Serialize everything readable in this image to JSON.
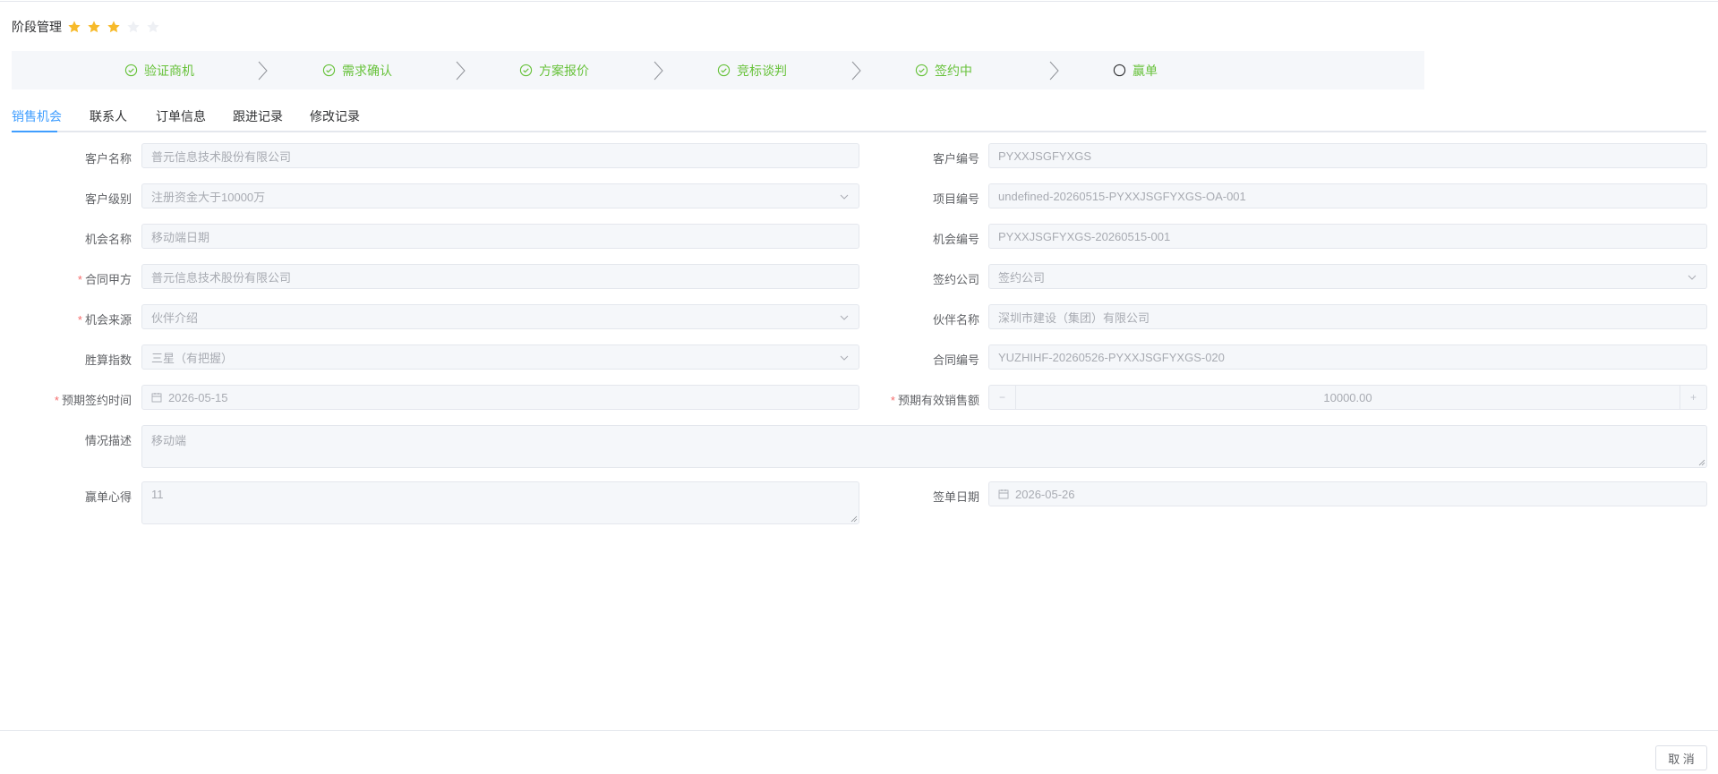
{
  "stage": {
    "title": "阶段管理",
    "rating": 3,
    "rating_max": 5
  },
  "steps": [
    {
      "label": "验证商机",
      "status": "done"
    },
    {
      "label": "需求确认",
      "status": "done"
    },
    {
      "label": "方案报价",
      "status": "done"
    },
    {
      "label": "竞标谈判",
      "status": "done"
    },
    {
      "label": "签约中",
      "status": "done"
    },
    {
      "label": "赢单",
      "status": "current"
    }
  ],
  "tabs": [
    "销售机会",
    "联系人",
    "订单信息",
    "跟进记录",
    "修改记录"
  ],
  "form": {
    "customer_name": {
      "label": "客户名称",
      "value": "普元信息技术股份有限公司"
    },
    "customer_no": {
      "label": "客户编号",
      "value": "PYXXJSGFYXGS"
    },
    "customer_level": {
      "label": "客户级别",
      "value": "注册资金大于10000万"
    },
    "project_no": {
      "label": "项目编号",
      "value": "undefined-20260515-PYXXJSGFYXGS-OA-001"
    },
    "opp_name": {
      "label": "机会名称",
      "value": "移动端日期"
    },
    "opp_no": {
      "label": "机会编号",
      "value": "PYXXJSGFYXGS-20260515-001"
    },
    "contract_party": {
      "label": "合同甲方",
      "value": "普元信息技术股份有限公司"
    },
    "sign_company": {
      "label": "签约公司",
      "placeholder": "签约公司"
    },
    "opp_source": {
      "label": "机会来源",
      "value": "伙伴介绍"
    },
    "partner_name": {
      "label": "伙伴名称",
      "value": "深圳市建设（集团）有限公司"
    },
    "win_index": {
      "label": "胜算指数",
      "value": "三星（有把握）"
    },
    "contract_no": {
      "label": "合同编号",
      "value": "YUZHIHF-20260526-PYXXJSGFYXGS-020"
    },
    "expected_sign_date": {
      "label": "预期签约时间",
      "value": "2026-05-15"
    },
    "expected_sales": {
      "label": "预期有效销售额",
      "value": "10000.00",
      "minus": "−",
      "plus": "+"
    },
    "situation": {
      "label": "情况描述",
      "value": "移动端"
    },
    "win_notes": {
      "label": "赢单心得",
      "value": "11"
    },
    "sign_date": {
      "label": "签单日期",
      "value": "2026-05-26"
    }
  },
  "required_mark": "*",
  "footer": {
    "cancel_label": "取 消"
  },
  "colors": {
    "accent": "#409eff",
    "success": "#67c23a",
    "star": "#f7ba2a",
    "star_off": "#e4e7ed"
  }
}
